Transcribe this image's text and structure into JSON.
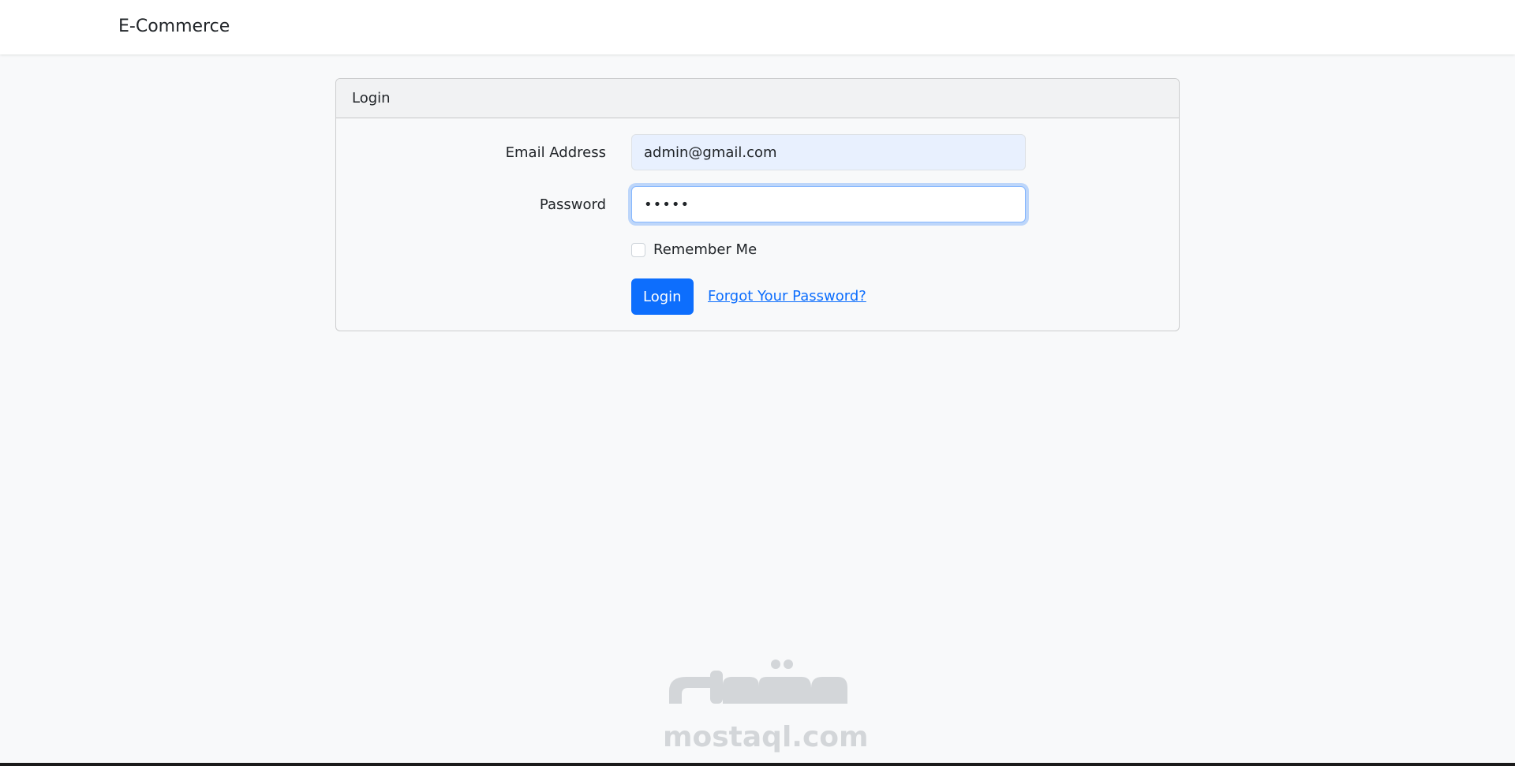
{
  "navbar": {
    "brand": "E-Commerce"
  },
  "login_card": {
    "title": "Login",
    "email_label": "Email Address",
    "email_value": "admin@gmail.com",
    "password_label": "Password",
    "password_value": "•••••",
    "remember_label": "Remember Me",
    "remember_checked": false,
    "submit_label": "Login",
    "forgot_label": "Forgot Your Password?"
  },
  "watermark": {
    "text": "mostaql.com",
    "icon": "mostaql-logo"
  },
  "colors": {
    "primary": "#0d6efd",
    "background": "#f8f9fa",
    "autofill": "#e8f0fe",
    "focus_ring": "#86b7fe"
  }
}
